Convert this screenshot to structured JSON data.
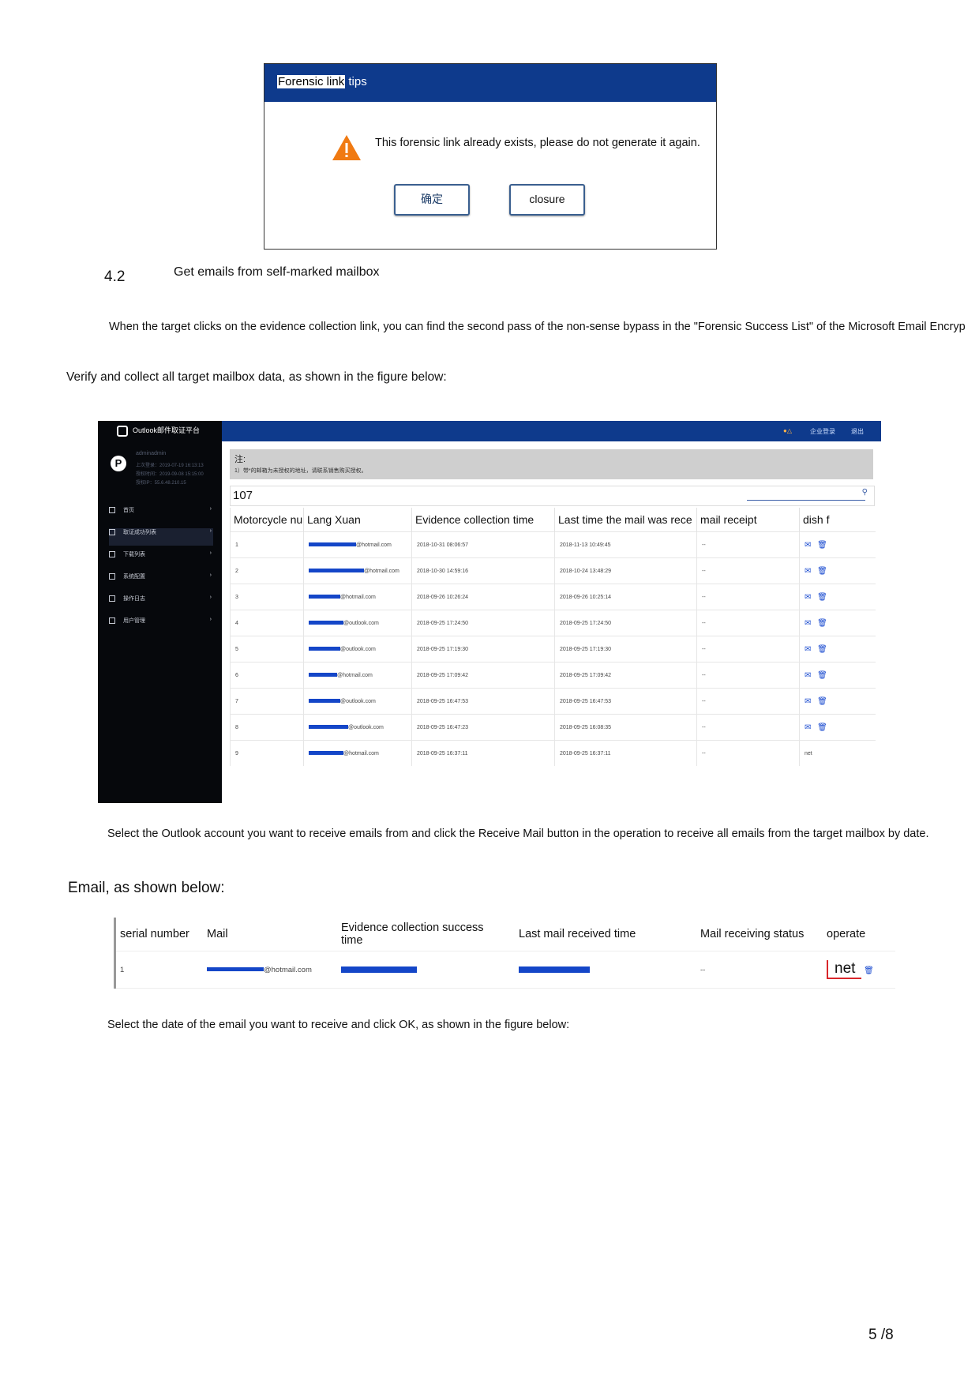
{
  "dialog": {
    "title_highlight": "Forensic link",
    "title_rest": " tips",
    "message": "This forensic link already exists, please do not generate it again.",
    "ok_label": "确定",
    "close_label": "closure"
  },
  "section": {
    "number": "4.2",
    "title": "Get emails from self-marked mailbox"
  },
  "paragraphs": {
    "p1": "When the target clicks on the evidence collection link, you can find the second pass of the non-sense bypass in the \"Forensic Success List\" of the Microsoft Email Encryp",
    "p2": "Verify and collect all target mailbox data, as shown in the figure below:",
    "p3": "Select the Outlook account you want to receive emails from and click the Receive Mail button in the operation to receive all emails from the target mailbox by date.",
    "p4": "Email, as shown below:",
    "p5": "Select the date of the email you want to receive and click OK, as shown in the figure below:"
  },
  "app": {
    "logo_text": "Outlook邮件取证平台",
    "top_links": [
      "企业登录",
      "退出"
    ],
    "user": {
      "name": "adminadmin",
      "lines": [
        "上次登录：2019-07-19 16:13:13",
        "授权时间：2019-09-08 15:15:00",
        "授权IP：55.6.48.210.15"
      ]
    },
    "menu": [
      "首页",
      "取证成功列表",
      "下载列表",
      "系统配置",
      "操作日志",
      "用户管理"
    ],
    "note_heading": "注:",
    "note_text": "1）带*的邮箱为未授权的地址，请联系销售购买授权。",
    "count": "107",
    "columns": [
      "Motorcycle num  ber",
      "Lang Xuan",
      "Evidence collection time",
      "Last time the mail was rece",
      "mail receipt",
      "dish f"
    ],
    "rows": [
      {
        "n": "1",
        "mail": "@hotmail.com",
        "t1": "2018-10-31 08:06:57",
        "t2": "2018-11-13 10:49:45",
        "status": "--"
      },
      {
        "n": "2",
        "mail": "@hotmail.com",
        "t1": "2018-10-30 14:59:16",
        "t2": "2018-10-24 13:48:29",
        "status": "--"
      },
      {
        "n": "3",
        "mail": "@hotmail.com",
        "t1": "2018-09-26 10:26:24",
        "t2": "2018-09-26 10:25:14",
        "status": "--"
      },
      {
        "n": "4",
        "mail": "@outlook.com",
        "t1": "2018-09-25 17:24:50",
        "t2": "2018-09-25 17:24:50",
        "status": "--"
      },
      {
        "n": "5",
        "mail": "@outlook.com",
        "t1": "2018-09-25 17:19:30",
        "t2": "2018-09-25 17:19:30",
        "status": "--"
      },
      {
        "n": "6",
        "mail": "@hotmail.com",
        "t1": "2018-09-25 17:09:42",
        "t2": "2018-09-25 17:09:42",
        "status": "--"
      },
      {
        "n": "7",
        "mail": "@outlook.com",
        "t1": "2018-09-25 16:47:53",
        "t2": "2018-09-25 16:47:53",
        "status": "--"
      },
      {
        "n": "8",
        "mail": "@outlook.com",
        "t1": "2018-09-25 16:47:23",
        "t2": "2018-09-25 16:08:35",
        "status": "--"
      },
      {
        "n": "9",
        "mail": "@hotmail.com",
        "t1": "2018-09-25 16:37:11",
        "t2": "2018-09-25 16:37:11",
        "status": "--"
      }
    ],
    "last_op_text": "net"
  },
  "table2": {
    "columns": [
      "serial number",
      "Mail",
      "Evidence collection success time",
      "Last mail received time",
      "Mail receiving status",
      "operate"
    ],
    "row": {
      "n": "1",
      "mail": "@hotmail.com",
      "status": "--",
      "op": "net"
    }
  },
  "page": "5 /8"
}
